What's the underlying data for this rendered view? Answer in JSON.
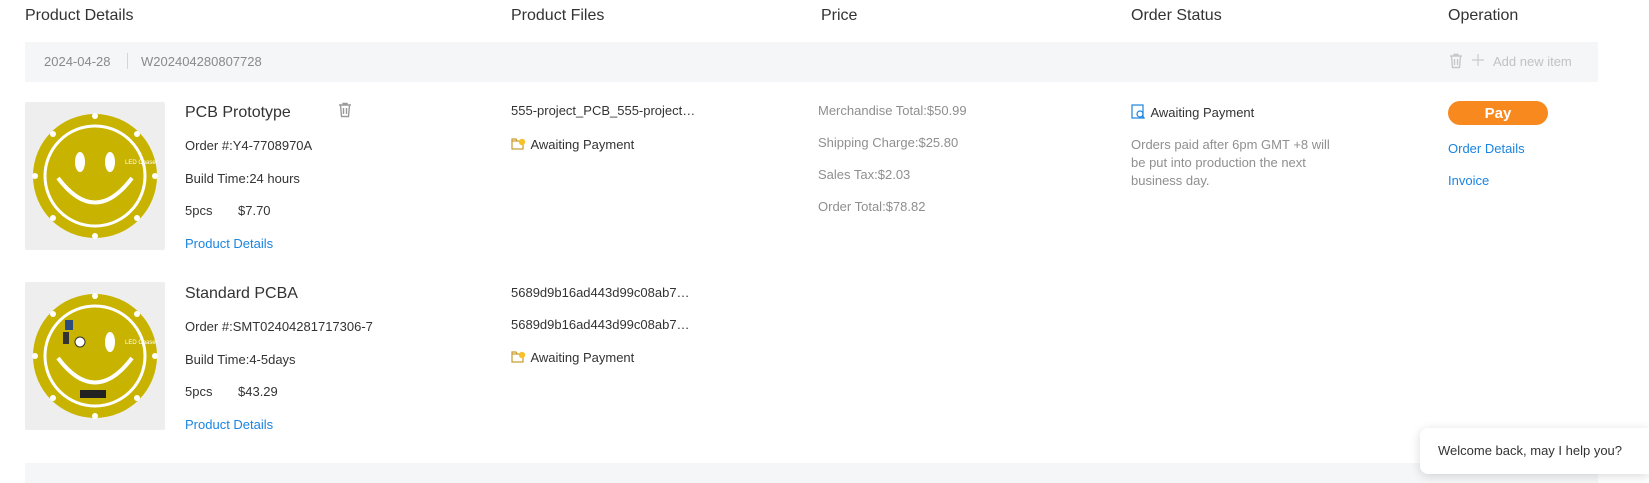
{
  "headers": {
    "product_details": "Product Details",
    "product_files": "Product Files",
    "price": "Price",
    "order_status": "Order Status",
    "operation": "Operation"
  },
  "order": {
    "date": "2024-04-28",
    "number": "W202404280807728",
    "add_new_item": "Add new item"
  },
  "items": [
    {
      "name": "PCB Prototype",
      "order_no_label": "Order #:",
      "order_no": "Y4-7708970A",
      "build_label": "Build Time:",
      "build_time": "24 hours",
      "qty": "5pcs",
      "price": "$7.70",
      "details_link": "Product Details",
      "files": [
        "555-project_PCB_555-project…"
      ],
      "file_status": "Awaiting Payment"
    },
    {
      "name": "Standard PCBA",
      "order_no_label": "Order #:",
      "order_no": "SMT02404281717306-7",
      "build_label": "Build Time:",
      "build_time": "4-5days",
      "qty": "5pcs",
      "price": "$43.29",
      "details_link": "Product Details",
      "files": [
        "5689d9b16ad443d99c08ab7…",
        "5689d9b16ad443d99c08ab7…"
      ],
      "file_status": "Awaiting Payment"
    }
  ],
  "price": {
    "merchandise_label": "Merchandise Total:",
    "merchandise": "$50.99",
    "shipping_label": "Shipping Charge:",
    "shipping": "$25.80",
    "tax_label": "Sales Tax:",
    "tax": "$2.03",
    "total_label": "Order Total:",
    "total": "$78.82"
  },
  "status": {
    "label": "Awaiting Payment",
    "note": "Orders paid after 6pm GMT +8 will be put into production the next business day."
  },
  "operation": {
    "pay": "Pay",
    "order_details": "Order Details",
    "invoice": "Invoice"
  },
  "chat": {
    "text": "Welcome back, may I help you?"
  },
  "colors": {
    "accent_orange": "#f7891f",
    "link_blue": "#1a84e0",
    "pcb_yellow": "#c8b400"
  }
}
